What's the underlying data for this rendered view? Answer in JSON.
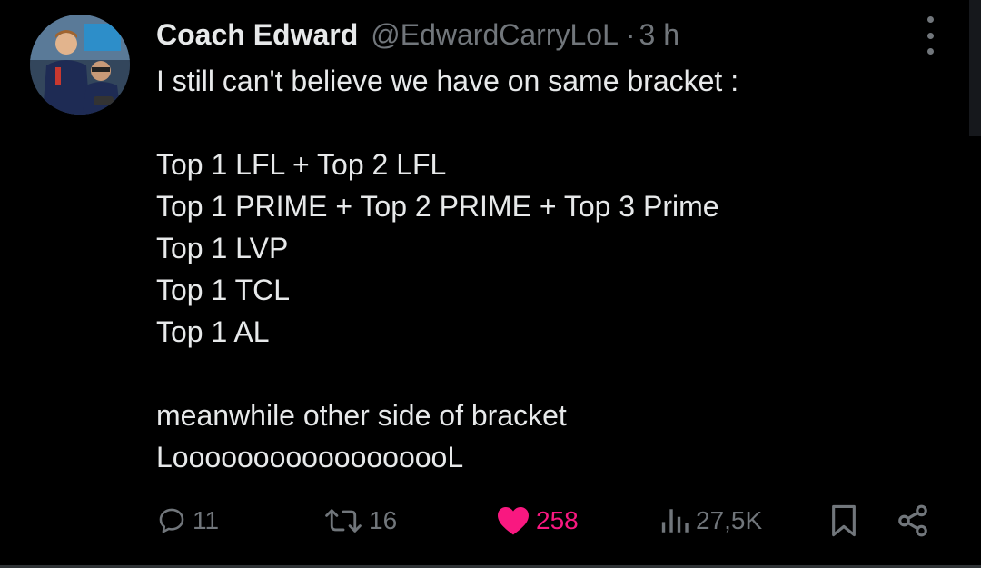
{
  "tweet": {
    "author_name": "Coach Edward",
    "handle": "@EdwardCarryLoL",
    "separator": "·",
    "timestamp": "3 h",
    "lines": [
      "I still can't believe we have on same bracket :",
      "",
      "Top 1 LFL + Top 2 LFL",
      "Top 1 PRIME + Top 2 PRIME + Top 3 Prime",
      "Top 1 LVP",
      "Top 1 TCL",
      "Top 1 AL",
      "",
      "meanwhile other side of bracket",
      "LoooooooooooooooooL"
    ]
  },
  "actions": {
    "replies": "11",
    "retweets": "16",
    "likes": "258",
    "views": "27,5K"
  },
  "colors": {
    "background": "#000000",
    "text": "#e7e9ea",
    "muted": "#71767b",
    "like": "#f91880"
  },
  "icons": [
    "more-icon",
    "reply-icon",
    "retweet-icon",
    "heart-icon",
    "views-icon",
    "bookmark-icon",
    "share-icon"
  ]
}
